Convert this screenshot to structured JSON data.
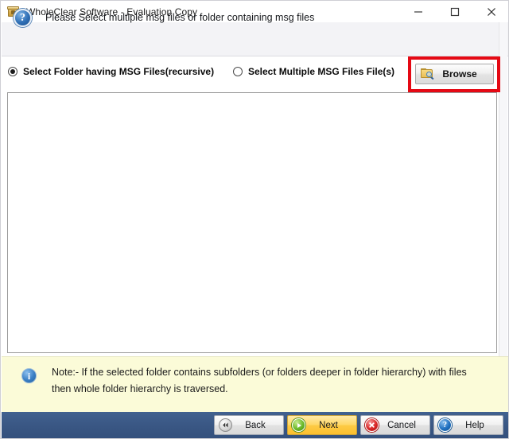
{
  "window": {
    "title": "WholeClear Software - Evaluation Copy",
    "app_icon": "package-box-icon",
    "controls": {
      "minimize": "minimize-icon",
      "maximize": "maximize-icon",
      "close": "close-icon"
    }
  },
  "header": {
    "icon": "question-mark-icon",
    "icon_glyph": "?",
    "instruction": "Please Select multiple msg files or folder containing msg files"
  },
  "options": {
    "items": [
      {
        "label": "Select Folder having MSG Files(recursive)",
        "selected": true
      },
      {
        "label": "Select Multiple MSG Files File(s)",
        "selected": false
      }
    ]
  },
  "browse": {
    "label": "Browse",
    "icon": "folder-search-icon",
    "highlight_color": "#e50914"
  },
  "list_area": {
    "items": []
  },
  "note": {
    "icon": "info-icon",
    "icon_glyph": "i",
    "text": "Note:- If the selected folder contains subfolders (or folders deeper in folder hierarchy) with files then whole folder hierarchy is traversed.",
    "background_color": "#fbfbd8"
  },
  "footer": {
    "background_color": "#3a5784",
    "buttons": [
      {
        "label": "Back",
        "icon": "rewind-icon",
        "glyph": "⏪",
        "style": "default"
      },
      {
        "label": "Next",
        "icon": "play-forward-icon",
        "glyph": "",
        "style": "primary"
      },
      {
        "label": "Cancel",
        "icon": "cancel-x-icon",
        "glyph": "✕",
        "style": "default"
      },
      {
        "label": "Help",
        "icon": "help-question-icon",
        "glyph": "?",
        "style": "default"
      }
    ]
  }
}
